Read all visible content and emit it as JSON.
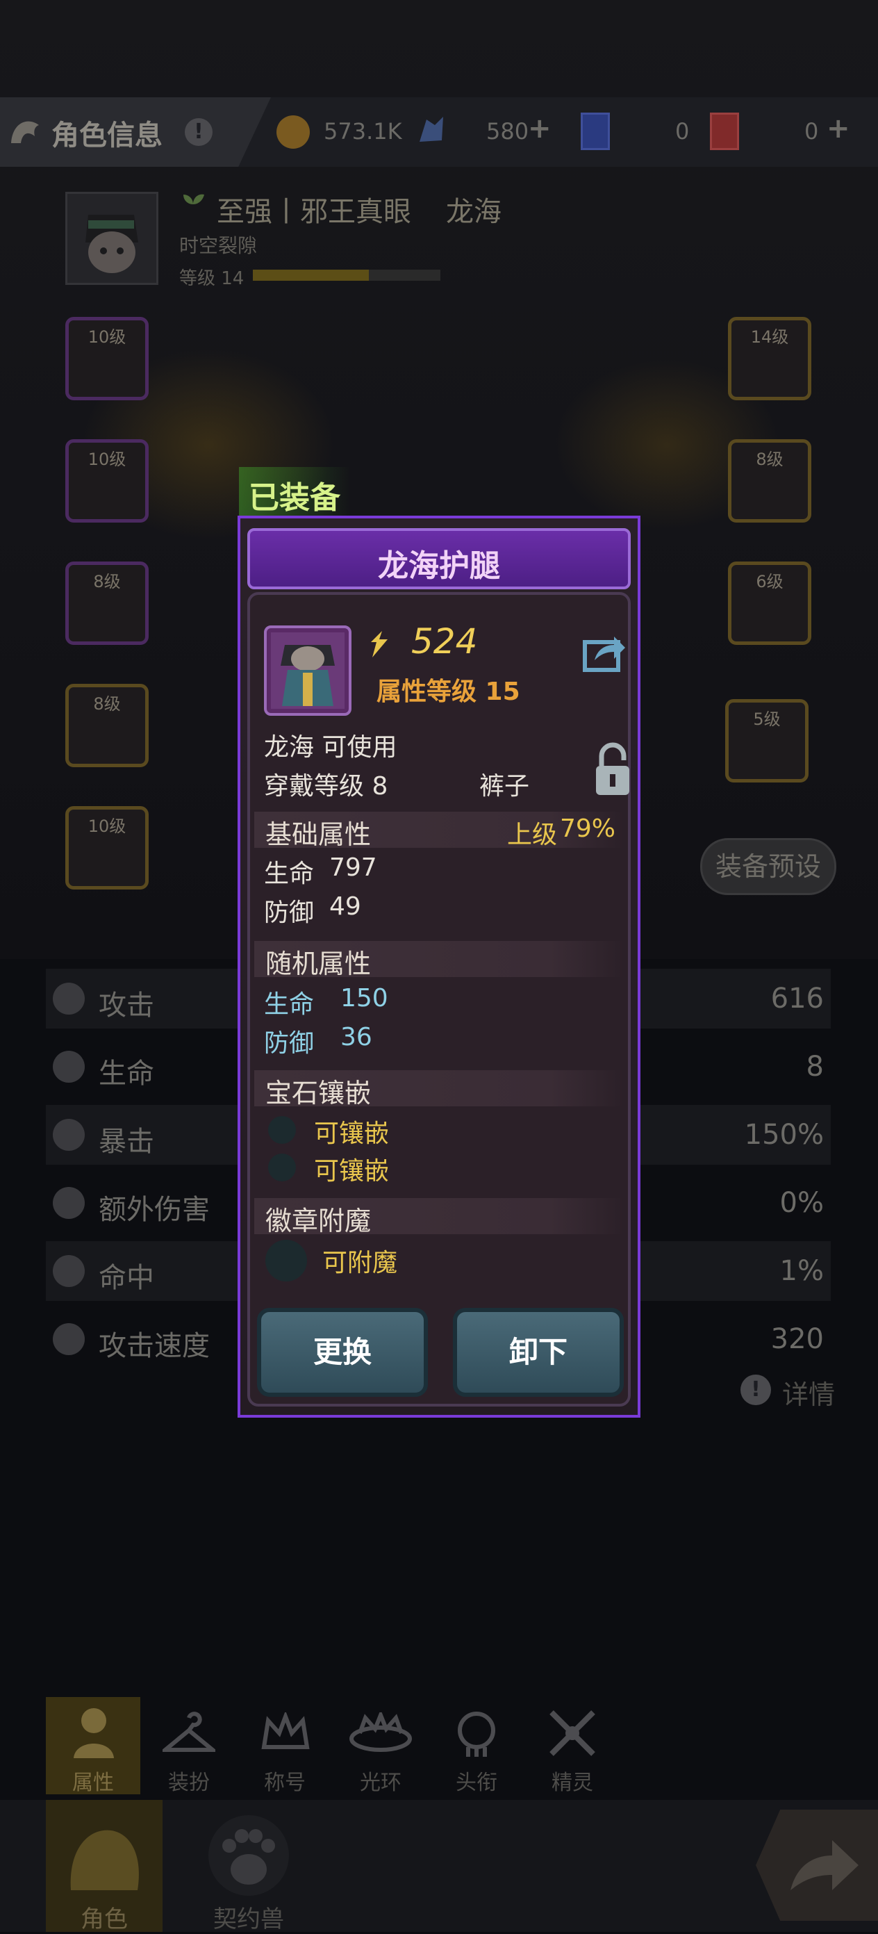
{
  "header": {
    "title": "角色信息",
    "warn": "!",
    "coins": "573.1K",
    "crystals": "580",
    "ticket_blue": "0",
    "ticket_red": "0"
  },
  "hero": {
    "title": "至强丨邪王真眼",
    "name": "龙海",
    "subtitle": "时空裂隙",
    "level_label": "等级 14",
    "level_progress": 0.62
  },
  "slots_left": [
    "10级",
    "10级",
    "8级",
    "8级",
    "10级"
  ],
  "slots_right": [
    "14级",
    "8级",
    "6级",
    "5级"
  ],
  "preset_button": "装备预设",
  "stats": [
    {
      "name": "攻击",
      "value": "616"
    },
    {
      "name": "生命",
      "value": "8"
    },
    {
      "name": "暴击",
      "value": "150%"
    },
    {
      "name": "额外伤害",
      "value": "0%"
    },
    {
      "name": "命中",
      "value": "1%"
    },
    {
      "name": "攻击速度",
      "value": "320"
    }
  ],
  "details_link": "详情",
  "tabs": [
    "属性",
    "装扮",
    "称号",
    "光环",
    "头衔",
    "精灵"
  ],
  "nav": [
    "角色",
    "契约兽"
  ],
  "equipped_tag": "已装备",
  "item": {
    "name": "龙海护腿",
    "power": "524",
    "attr_level": "属性等级 15",
    "usable": "龙海 可使用",
    "wear_level": "穿戴等级 8",
    "slot_type": "裤子",
    "base_title": "基础属性",
    "grade": "上级",
    "grade_pct": "79%",
    "base_stats": [
      {
        "name": "生命",
        "value": "797"
      },
      {
        "name": "防御",
        "value": "49"
      }
    ],
    "random_title": "随机属性",
    "random_stats": [
      {
        "name": "生命",
        "value": "150"
      },
      {
        "name": "防御",
        "value": "36"
      }
    ],
    "gem_title": "宝石镶嵌",
    "gems": [
      "可镶嵌",
      "可镶嵌"
    ],
    "badge_title": "徽章附魔",
    "badge": "可附魔",
    "btn_replace": "更换",
    "btn_unequip": "卸下"
  },
  "colors": {
    "accent_purple": "#7a3bd8",
    "gold": "#e9c64d",
    "cyan": "#8fd1e6"
  }
}
